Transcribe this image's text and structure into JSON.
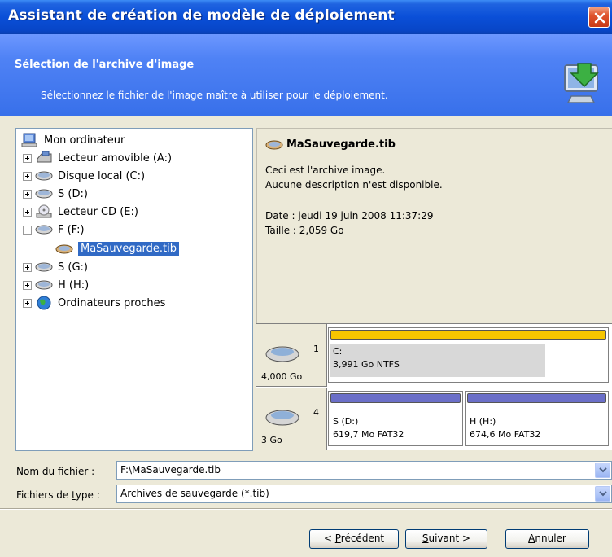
{
  "window": {
    "title": "Assistant de création de modèle de déploiement"
  },
  "header": {
    "title": "Sélection de l'archive d'image",
    "subtitle": "Sélectionnez le fichier de l'image maître à utiliser pour le déploiement."
  },
  "tree": {
    "items": [
      {
        "label": "Mon ordinateur",
        "icon": "computer-icon",
        "expander": "none"
      },
      {
        "label": "Lecteur amovible (A:)",
        "icon": "floppy-drive-icon",
        "expander": "plus"
      },
      {
        "label": "Disque local (C:)",
        "icon": "hard-drive-icon",
        "expander": "plus"
      },
      {
        "label": "S (D:)",
        "icon": "hard-drive-icon",
        "expander": "plus"
      },
      {
        "label": "Lecteur CD (E:)",
        "icon": "cd-drive-icon",
        "expander": "plus"
      },
      {
        "label": "F (F:)",
        "icon": "hard-drive-icon",
        "expander": "minus"
      },
      {
        "label": "MaSauvegarde.tib",
        "icon": "archive-icon",
        "expander": "none",
        "selected": true
      },
      {
        "label": "S (G:)",
        "icon": "hard-drive-icon",
        "expander": "plus"
      },
      {
        "label": "H (H:)",
        "icon": "hard-drive-icon",
        "expander": "plus"
      },
      {
        "label": "Ordinateurs proches",
        "icon": "network-globe-icon",
        "expander": "plus"
      }
    ]
  },
  "info": {
    "name": "MaSauvegarde.tib",
    "line1": "Ceci est l'archive image.",
    "line2": "Aucune description n'est disponible.",
    "date": "Date : jeudi 19 juin 2008 11:37:29",
    "size": "Taille : 2,059 Go"
  },
  "disks": [
    {
      "number": "1",
      "size": "4,000 Go",
      "partitions": [
        {
          "label": "C:",
          "detail": "3,991 Go  NTFS",
          "bar_color": "#f7c600",
          "used_fraction": 0.78
        }
      ]
    },
    {
      "number": "4",
      "size": "3 Go",
      "partitions": [
        {
          "label": "S (D:)",
          "detail": "619,7 Mo  FAT32",
          "bar_color": "#6b6fc8",
          "used_fraction": 0
        },
        {
          "label": "H (H:)",
          "detail": "674,6 Mo  FAT32",
          "bar_color": "#6b6fc8",
          "used_fraction": 0
        }
      ]
    }
  ],
  "fields": {
    "filename_label_pre": "Nom du ",
    "filename_label_key": "f",
    "filename_label_post": "ichier :",
    "filename_value": "F:\\MaSauvegarde.tib",
    "filetype_label_pre": "Fichiers de ",
    "filetype_label_key": "t",
    "filetype_label_post": "ype :",
    "filetype_value": "Archives de sauvegarde (*.tib)"
  },
  "buttons": {
    "back_pre": "< ",
    "back_key": "P",
    "back_post": "récédent",
    "next_key": "S",
    "next_post": "uivant >",
    "cancel_key": "A",
    "cancel_post": "nnuler"
  },
  "colors": {
    "title_bar": "#0a4fd8",
    "header": "#4f82f5",
    "selection": "#316ac5"
  }
}
